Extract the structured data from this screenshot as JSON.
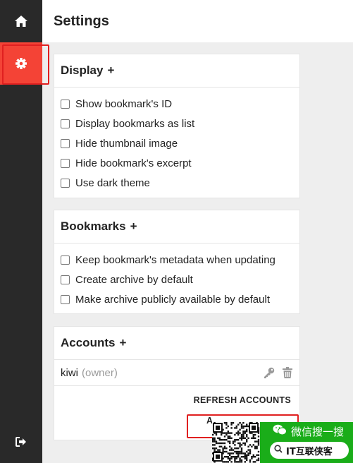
{
  "sidebar": {
    "items": [
      {
        "icon": "home-icon"
      },
      {
        "icon": "gear-icon",
        "active": true
      },
      {
        "icon": "logout-icon"
      }
    ],
    "active_color": "#f44336",
    "background": "#292929"
  },
  "header": {
    "title": "Settings"
  },
  "display": {
    "title": "Display",
    "toggle": "+",
    "options": [
      {
        "label": "Show bookmark's ID",
        "checked": false
      },
      {
        "label": "Display bookmarks as list",
        "checked": false
      },
      {
        "label": "Hide thumbnail image",
        "checked": false
      },
      {
        "label": "Hide bookmark's excerpt",
        "checked": false
      },
      {
        "label": "Use dark theme",
        "checked": false
      }
    ]
  },
  "bookmarks": {
    "title": "Bookmarks",
    "toggle": "+",
    "options": [
      {
        "label": "Keep bookmark's metadata when updating",
        "checked": false
      },
      {
        "label": "Create archive by default",
        "checked": false
      },
      {
        "label": "Make archive publicly available by default",
        "checked": false
      }
    ]
  },
  "accounts": {
    "title": "Accounts",
    "toggle": "+",
    "list": [
      {
        "username": "kiwi",
        "role": "(owner)",
        "icons": [
          "key-icon",
          "trash-icon"
        ]
      }
    ],
    "refresh_label": "REFRESH ACCOUNTS",
    "add_label": "A"
  },
  "watermark": {
    "line1": "微信搜一搜",
    "line2": "IT互联侠客",
    "color": "#1aad19"
  }
}
